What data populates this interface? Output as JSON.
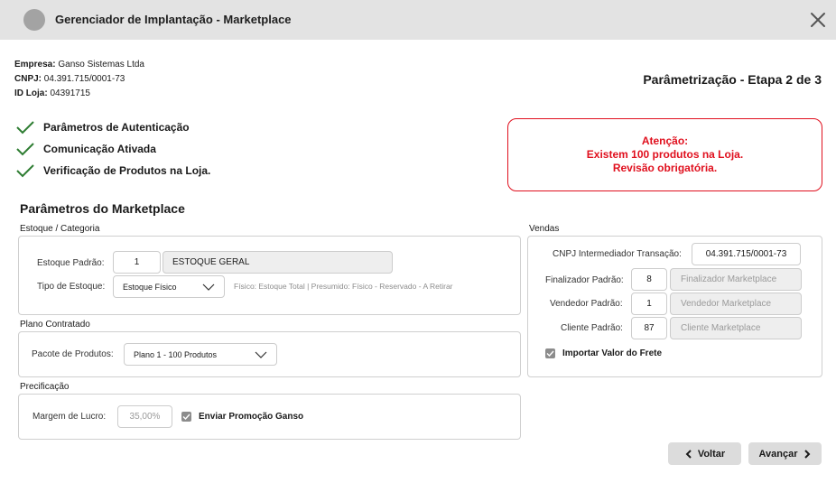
{
  "window": {
    "title": "Gerenciador de Implantação - Marketplace"
  },
  "company": {
    "empresa_label": "Empresa:",
    "empresa_value": "Ganso Sistemas Ltda",
    "cnpj_label": "CNPJ:",
    "cnpj_value": "04.391.715/0001-73",
    "idloja_label": "ID Loja:",
    "idloja_value": "04391715"
  },
  "step_title": "Parâmetrização - Etapa 2 de 3",
  "checklist": [
    "Parâmetros de Autenticação",
    "Comunicação Ativada",
    "Verificação de Produtos na Loja."
  ],
  "alert": {
    "line1": "Atenção:",
    "line2": "Existem 100 produtos na Loja.",
    "line3": "Revisão obrigatória."
  },
  "section_title": "Parâmetros do Marketplace",
  "estoque": {
    "group_label": "Estoque / Categoria",
    "padrao_label": "Estoque Padrão:",
    "padrao_code": "1",
    "padrao_name": "ESTOQUE GERAL",
    "tipo_label": "Tipo de Estoque:",
    "tipo_value": "Estoque Físico",
    "hint": "Físico: Estoque Total | Presumido: Físico - Reservado - A Retirar"
  },
  "plano": {
    "group_label": "Plano Contratado",
    "pacote_label": "Pacote de Produtos:",
    "pacote_value": "Plano 1 - 100 Produtos"
  },
  "precificacao": {
    "group_label": "Precificação",
    "margem_label": "Margem de Lucro:",
    "margem_value": "35,00%",
    "promo_label": "Enviar Promoção Ganso",
    "promo_checked": true
  },
  "vendas": {
    "group_label": "Vendas",
    "cnpj_label": "CNPJ Intermediador Transação:",
    "cnpj_value": "04.391.715/0001-73",
    "finalizador_label": "Finalizador Padrão:",
    "finalizador_code": "8",
    "finalizador_name": "Finalizador Marketplace",
    "vendedor_label": "Vendedor Padrão:",
    "vendedor_code": "1",
    "vendedor_name": "Vendedor Marketplace",
    "cliente_label": "Cliente Padrão:",
    "cliente_code": "87",
    "cliente_name": "Cliente Marketplace",
    "frete_label": "Importar Valor do Frete",
    "frete_checked": true
  },
  "buttons": {
    "back_label": "Voltar",
    "next_label": "Avançar"
  },
  "icons": {
    "app": "app-logo-icon",
    "close": "close-icon",
    "check": "checkmark-icon",
    "dropdown": "chevron-down-icon",
    "back": "chevron-left-icon",
    "next": "chevron-right-icon"
  },
  "colors": {
    "titlebar": "#e3e3e3",
    "check_green": "#2e7d32",
    "alert_red": "#e0101e",
    "button_bg": "#dcdcdc"
  }
}
